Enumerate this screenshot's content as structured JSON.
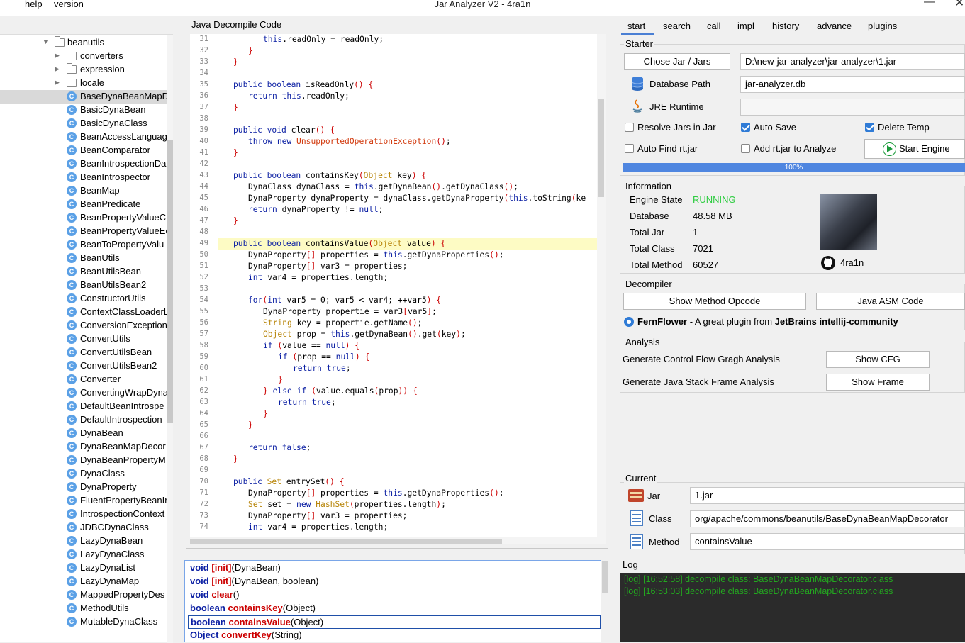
{
  "window": {
    "title": "Jar Analyzer V2 - 4ra1n"
  },
  "menu": {
    "help": "help",
    "version": "version"
  },
  "tree": {
    "root": "beanutils",
    "folders": [
      "converters",
      "expression",
      "locale"
    ],
    "classes": [
      "BaseDynaBeanMapD",
      "BasicDynaBean",
      "BasicDynaClass",
      "BeanAccessLanguage",
      "BeanComparator",
      "BeanIntrospectionDa",
      "BeanIntrospector",
      "BeanMap",
      "BeanPredicate",
      "BeanPropertyValueCl",
      "BeanPropertyValueEc",
      "BeanToPropertyValu",
      "BeanUtils",
      "BeanUtilsBean",
      "BeanUtilsBean2",
      "ConstructorUtils",
      "ContextClassLoaderL",
      "ConversionException",
      "ConvertUtils",
      "ConvertUtilsBean",
      "ConvertUtilsBean2",
      "Converter",
      "ConvertingWrapDyna",
      "DefaultBeanIntrospe",
      "DefaultIntrospection",
      "DynaBean",
      "DynaBeanMapDecor",
      "DynaBeanPropertyM",
      "DynaClass",
      "DynaProperty",
      "FluentPropertyBeanIr",
      "IntrospectionContext",
      "JDBCDynaClass",
      "LazyDynaBean",
      "LazyDynaClass",
      "LazyDynaList",
      "LazyDynaMap",
      "MappedPropertyDes",
      "MethodUtils",
      "MutableDynaClass"
    ],
    "class_icon_letter": "C"
  },
  "code": {
    "title": "Java Decompile Code",
    "lines": [
      {
        "n": "31",
        "code": "this.readOnly = readOnly;"
      },
      {
        "n": "32",
        "code": "}"
      },
      {
        "n": "33",
        "code": "}"
      },
      {
        "n": "34",
        "code": ""
      },
      {
        "n": "35",
        "code": "public boolean isReadOnly() {"
      },
      {
        "n": "36",
        "code": "return this.readOnly;"
      },
      {
        "n": "37",
        "code": "}"
      },
      {
        "n": "38",
        "code": ""
      },
      {
        "n": "39",
        "code": "public void clear() {"
      },
      {
        "n": "40",
        "code": "throw new UnsupportedOperationException();"
      },
      {
        "n": "41",
        "code": "}"
      },
      {
        "n": "42",
        "code": ""
      },
      {
        "n": "43",
        "code": "public boolean containsKey(Object key) {"
      },
      {
        "n": "44",
        "code": "DynaClass dynaClass = this.getDynaBean().getDynaClass();"
      },
      {
        "n": "45",
        "code": "DynaProperty dynaProperty = dynaClass.getDynaProperty(this.toString(ke"
      },
      {
        "n": "46",
        "code": "return dynaProperty != null;"
      },
      {
        "n": "47",
        "code": "}"
      },
      {
        "n": "48",
        "code": ""
      },
      {
        "n": "49",
        "code": "public boolean containsValue(Object value) {"
      },
      {
        "n": "50",
        "code": "DynaProperty[] properties = this.getDynaProperties();"
      },
      {
        "n": "51",
        "code": "DynaProperty[] var3 = properties;"
      },
      {
        "n": "52",
        "code": "int var4 = properties.length;"
      },
      {
        "n": "53",
        "code": ""
      },
      {
        "n": "54",
        "code": "for(int var5 = 0; var5 < var4; ++var5) {"
      },
      {
        "n": "55",
        "code": "DynaProperty propertie = var3[var5];"
      },
      {
        "n": "56",
        "code": "String key = propertie.getName();"
      },
      {
        "n": "57",
        "code": "Object prop = this.getDynaBean().get(key);"
      },
      {
        "n": "58",
        "code": "if (value == null) {"
      },
      {
        "n": "59",
        "code": "if (prop == null) {"
      },
      {
        "n": "60",
        "code": "return true;"
      },
      {
        "n": "61",
        "code": "}"
      },
      {
        "n": "62",
        "code": "} else if (value.equals(prop)) {"
      },
      {
        "n": "63",
        "code": "return true;"
      },
      {
        "n": "64",
        "code": "}"
      },
      {
        "n": "65",
        "code": "}"
      },
      {
        "n": "66",
        "code": ""
      },
      {
        "n": "67",
        "code": "return false;"
      },
      {
        "n": "68",
        "code": "}"
      },
      {
        "n": "69",
        "code": ""
      },
      {
        "n": "70",
        "code": "public Set entrySet() {"
      },
      {
        "n": "71",
        "code": "DynaProperty[] properties = this.getDynaProperties();"
      },
      {
        "n": "72",
        "code": "Set set = new HashSet(properties.length);"
      },
      {
        "n": "73",
        "code": "DynaProperty[] var3 = properties;"
      },
      {
        "n": "74",
        "code": "int var4 = properties.length;"
      }
    ]
  },
  "methods": [
    {
      "ret": "void",
      "name": "[init]",
      "args": "(DynaBean)"
    },
    {
      "ret": "void",
      "name": "[init]",
      "args": "(DynaBean, boolean)"
    },
    {
      "ret": "void",
      "name": "clear",
      "args": "()"
    },
    {
      "ret": "boolean",
      "name": "containsKey",
      "args": "(Object)"
    },
    {
      "ret": "boolean",
      "name": "containsValue",
      "args": "(Object)"
    },
    {
      "ret": "Object",
      "name": "convertKey",
      "args": "(String)"
    }
  ],
  "tabs": [
    "start",
    "search",
    "call",
    "impl",
    "history",
    "advance",
    "plugins"
  ],
  "starter": {
    "label": "Starter",
    "chose_jar_button": "Chose Jar / Jars",
    "jar_path": "D:\\new-jar-analyzer\\jar-analyzer\\1.jar",
    "database_path_label": "Database Path",
    "database_path": "jar-analyzer.db",
    "jre_runtime_label": "JRE Runtime",
    "jre_runtime": "",
    "resolve_jars": "Resolve Jars in Jar",
    "auto_save": "Auto Save",
    "delete_temp": "Delete Temp",
    "auto_find_rt": "Auto Find rt.jar",
    "add_rt": "Add rt.jar to Analyze",
    "start_engine": "Start Engine",
    "progress": "100%"
  },
  "information": {
    "label": "Information",
    "engine_state_label": "Engine State",
    "engine_state": "RUNNING",
    "database_label": "Database",
    "database": "48.58 MB",
    "total_jar_label": "Total Jar",
    "total_jar": "1",
    "total_class_label": "Total Class",
    "total_class": "7021",
    "total_method_label": "Total Method",
    "total_method": "60527",
    "author": "4ra1n",
    "state_color": "#2ecc40"
  },
  "decompiler": {
    "label": "Decompiler",
    "opcode_button": "Show Method Opcode",
    "asm_button": "Java ASM Code",
    "fernflower_name": "FernFlower",
    "fernflower_desc": " - A great plugin from ",
    "fernflower_vendor": "JetBrains intellij-community"
  },
  "analysis": {
    "label": "Analysis",
    "cfg_text": "Generate Control Flow Gragh Analysis",
    "cfg_button": "Show CFG",
    "frame_text": "Generate Java Stack Frame Analysis",
    "frame_button": "Show Frame"
  },
  "current": {
    "label": "Current",
    "jar_label": "Jar",
    "jar": "1.jar",
    "class_label": "Class",
    "class": "org/apache/commons/beanutils/BaseDynaBeanMapDecorator",
    "method_label": "Method",
    "method": "containsValue"
  },
  "log": {
    "label": "Log",
    "lines": [
      "[log] [16:52:58] decompile class: BaseDynaBeanMapDecorator.class",
      "[log] [16:53:03] decompile class: BaseDynaBeanMapDecorator.class"
    ]
  }
}
